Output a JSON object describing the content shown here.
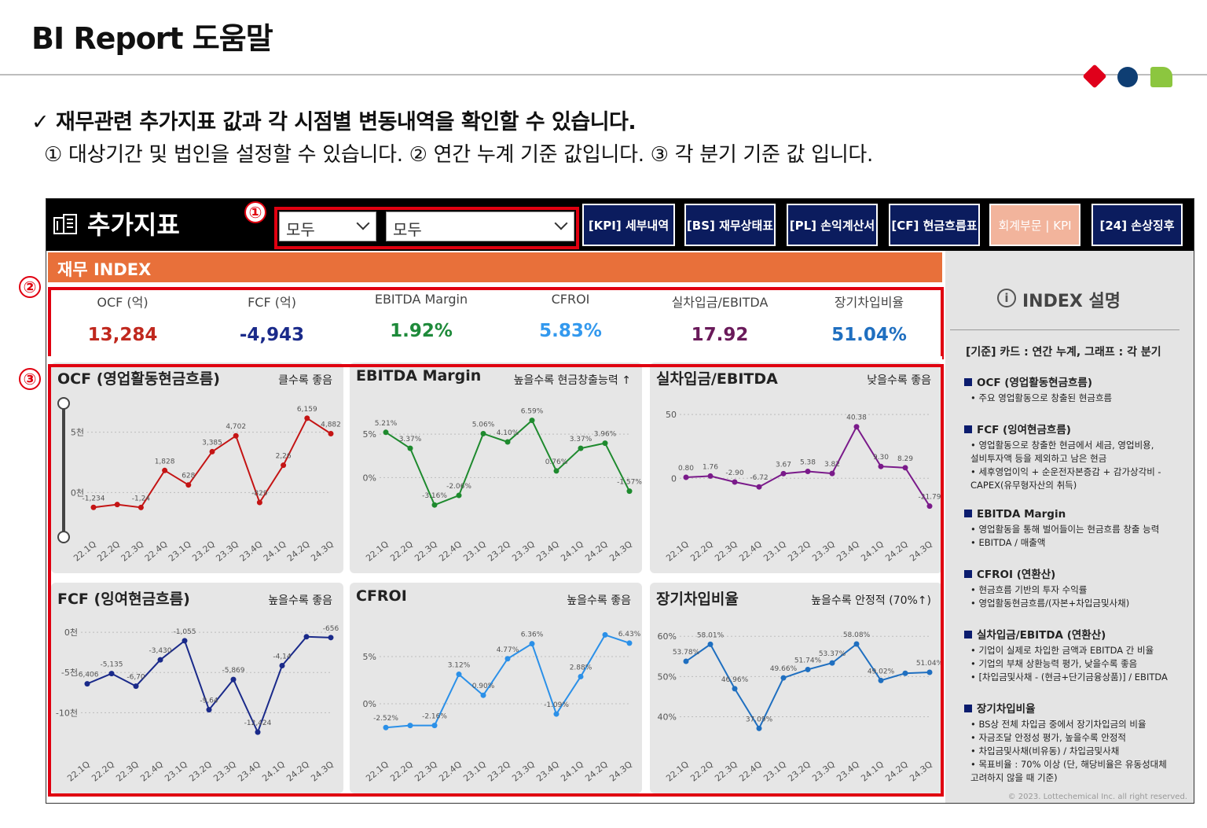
{
  "page": {
    "title": "BI Report 도움말",
    "line1": "✓ 재무관련 추가지표 값과 각 시점별 변동내역을 확인할 수 있습니다.",
    "line2": "① 대상기간 및 법인을 설정할 수 있습니다.  ② 연간 누계 기준 값입니다.  ③ 각 분기 기준 값 입니다."
  },
  "markers": [
    "①",
    "②",
    "③"
  ],
  "app": {
    "title": "추가지표",
    "slicer1": "모두",
    "slicer2": "모두",
    "nav": [
      "[KPI] 세부내역",
      "[BS] 재무상태표",
      "[PL] 손익계산서",
      "[CF] 현금흐름표",
      "회계부문 | KPI",
      "[24] 손상징후"
    ]
  },
  "index": {
    "header": "재무 INDEX",
    "kpis": [
      {
        "label": "OCF (억)",
        "value": "13,284",
        "color": "#c0281e"
      },
      {
        "label": "FCF (억)",
        "value": "-4,943",
        "color": "#1a2a8a"
      },
      {
        "label": "EBITDA Margin",
        "value": "1.92%",
        "color": "#1e8a3a"
      },
      {
        "label": "CFROI",
        "value": "5.83%",
        "color": "#3399ee"
      },
      {
        "label": "실차입금/EBITDA",
        "value": "17.92",
        "color": "#6a1a5a"
      },
      {
        "label": "장기차입비율",
        "value": "51.04%",
        "color": "#1f6fc0"
      }
    ]
  },
  "chart_data": [
    {
      "type": "line",
      "title": "OCF (영업활동현금흐름)",
      "subtitle": "클수록 좋음",
      "color": "#c41414",
      "x": [
        "22.1Q",
        "22.2Q",
        "22.3Q",
        "22.4Q",
        "23.1Q",
        "23.2Q",
        "23.3Q",
        "23.4Q",
        "24.1Q",
        "24.2Q",
        "24.3Q"
      ],
      "y": [
        -1234,
        -1000,
        -1240,
        1828,
        628,
        3385,
        4702,
        -829,
        2260,
        6159,
        4882
      ],
      "labels": [
        "-1,234",
        "",
        "-1,24",
        "1,828",
        "628",
        "3,385",
        "4,702",
        "-829",
        "2,26",
        "6,159",
        "4,882"
      ],
      "yticks": [
        {
          "v": 5000,
          "t": "5천"
        },
        {
          "v": 0,
          "t": "0천"
        }
      ],
      "ylim": [
        -2000,
        7000
      ]
    },
    {
      "type": "line",
      "title": "EBITDA Margin",
      "subtitle": "높을수록 현금창출능력 ↑",
      "color": "#1e8a2e",
      "x": [
        "22.1Q",
        "22.2Q",
        "22.3Q",
        "22.4Q",
        "23.1Q",
        "23.2Q",
        "23.3Q",
        "23.4Q",
        "24.1Q",
        "24.2Q",
        "24.3Q"
      ],
      "y": [
        5.21,
        3.37,
        -3.16,
        -2.06,
        5.06,
        4.1,
        6.59,
        0.76,
        3.37,
        3.96,
        -1.57
      ],
      "labels": [
        "5.21%",
        "3.37%",
        "-3.16%",
        "-2.06%",
        "5.06%",
        "4.10%",
        "6.59%",
        "0.76%",
        "3.37%",
        "3.96%",
        "-1.57%"
      ],
      "yticks": [
        {
          "v": 5,
          "t": "5%"
        },
        {
          "v": 0,
          "t": "0%"
        }
      ],
      "ylim": [
        -4.5,
        8
      ]
    },
    {
      "type": "line",
      "title": "실차입금/EBITDA",
      "subtitle": "낮을수록 좋음",
      "color": "#7a1a8a",
      "x": [
        "22.1Q",
        "22.2Q",
        "22.3Q",
        "22.4Q",
        "23.1Q",
        "23.2Q",
        "23.3Q",
        "23.4Q",
        "24.1Q",
        "24.2Q",
        "24.3Q"
      ],
      "y": [
        0.8,
        1.76,
        -2.9,
        -6.72,
        3.67,
        5.38,
        3.82,
        40.38,
        9.3,
        8.29,
        -21.79
      ],
      "labels": [
        "0.80",
        "1.76",
        "-2.90",
        "-6.72",
        "3.67",
        "5.38",
        "3.82",
        "40.38",
        "9.30",
        "8.29",
        "-21.79"
      ],
      "yticks": [
        {
          "v": 50,
          "t": "50"
        },
        {
          "v": 0,
          "t": "0"
        }
      ],
      "ylim": [
        -30,
        55
      ]
    },
    {
      "type": "line",
      "title": "FCF (잉여현금흐름)",
      "subtitle": "높을수록 좋음",
      "color": "#1a2a8a",
      "x": [
        "22.1Q",
        "22.2Q",
        "22.3Q",
        "22.4Q",
        "23.1Q",
        "23.2Q",
        "23.3Q",
        "23.4Q",
        "24.1Q",
        "24.2Q",
        "24.3Q"
      ],
      "y": [
        -6406,
        -5135,
        -6700,
        -3430,
        -1055,
        -9640,
        -5869,
        -12424,
        -4147,
        -556,
        -656
      ],
      "labels": [
        "-6,406",
        "-5,135",
        "-6,70",
        "-3,430",
        "-1,055",
        "-9,64",
        "-5,869",
        "-12,424",
        "-4,14",
        "",
        "-656"
      ],
      "yticks": [
        {
          "v": 0,
          "t": "0천"
        },
        {
          "v": -5000,
          "t": "-5천"
        },
        {
          "v": -10000,
          "t": "-10천"
        }
      ],
      "ylim": [
        -13000,
        500
      ]
    },
    {
      "type": "line",
      "title": "CFROI",
      "subtitle": "높을수록 좋음",
      "color": "#2b90e8",
      "x": [
        "22.1Q",
        "22.2Q",
        "22.3Q",
        "22.4Q",
        "23.1Q",
        "23.2Q",
        "23.3Q",
        "23.4Q",
        "24.1Q",
        "24.2Q",
        "24.3Q"
      ],
      "y": [
        -2.52,
        -2.3,
        -2.3,
        3.12,
        0.9,
        4.77,
        6.36,
        -1.09,
        2.88,
        7.3,
        6.43
      ],
      "labels": [
        "-2.52%",
        "",
        "-2.16%",
        "3.12%",
        "0.90%",
        "4.77%",
        "6.36%",
        "-1.09%",
        "2.88%",
        "",
        "6.43%"
      ],
      "yticks": [
        {
          "v": 5,
          "t": "5%"
        },
        {
          "v": 0,
          "t": "0%"
        }
      ],
      "ylim": [
        -3.5,
        8
      ]
    },
    {
      "type": "line",
      "title": "장기차입비율",
      "subtitle": "높을수록 안정적 (70%↑)",
      "color": "#1f6fc0",
      "x": [
        "22.1Q",
        "22.2Q",
        "22.3Q",
        "22.4Q",
        "23.1Q",
        "23.2Q",
        "23.3Q",
        "23.4Q",
        "24.1Q",
        "24.2Q",
        "24.3Q"
      ],
      "y": [
        53.78,
        58.01,
        46.96,
        37.09,
        49.66,
        51.74,
        53.37,
        58.08,
        49.02,
        50.8,
        51.04
      ],
      "labels": [
        "53.78%",
        "58.01%",
        "46.96%",
        "37.09%",
        "49.66%",
        "51.74%",
        "53.37%",
        "58.08%",
        "49.02%",
        "",
        "51.04%"
      ],
      "yticks": [
        {
          "v": 60,
          "t": "60%"
        },
        {
          "v": 50,
          "t": "50%"
        },
        {
          "v": 40,
          "t": "40%"
        }
      ],
      "ylim": [
        35,
        62
      ]
    }
  ],
  "side": {
    "header": "INDEX 설명",
    "basis": "[기준] 카드 : 연간 누계, 그래프 : 각 분기",
    "items": [
      {
        "title": "OCF (영업활동현금흐름)",
        "bullets": [
          "• 주요 영업활동으로 창출된 현금흐름"
        ]
      },
      {
        "title": "FCF (잉여현금흐름)",
        "bullets": [
          "• 영업활동으로 창출한 현금에서 세금, 영업비용,",
          "   설비투자액 등을 제외하고 남은 현금",
          "• 세후영업이익 + 순운전자본증감 + 감가상각비 -",
          "   CAPEX(유무형자산의 취득)"
        ]
      },
      {
        "title": "EBITDA Margin",
        "bullets": [
          "• 영업활동을 통해 벌어들이는 현금흐름 창출 능력",
          "•  EBITDA / 매출액"
        ]
      },
      {
        "title": "CFROI (연환산)",
        "bullets": [
          "•  현금흐름 기반의 투자 수익률",
          "•  영업활동현금흐름/(자본+차입금및사채)"
        ]
      },
      {
        "title": "실차입금/EBITDA (연환산)",
        "bullets": [
          "• 기업이 실제로 차입한 금액과 EBITDA 간 비율",
          "• 기업의 부채 상환능력 평가, 낮을수록 좋음",
          "• [차입금및사채 - (현금+단기금융상품)] / EBITDA"
        ]
      },
      {
        "title": "장기차입비율",
        "bullets": [
          "• BS상 전체 차입금 중에서 장기차입금의 비율",
          "• 자금조달 안정성 평가, 높을수록 안정적",
          "• 차입금및사채(비유동) / 차입금및사채",
          "• 목표비율 : 70% 이상 (단, 해당비율은 유동성대체",
          "   고려하지 않을 때 기준)"
        ]
      }
    ],
    "copyright": "© 2023. Lottechemical Inc. all right reserved."
  }
}
